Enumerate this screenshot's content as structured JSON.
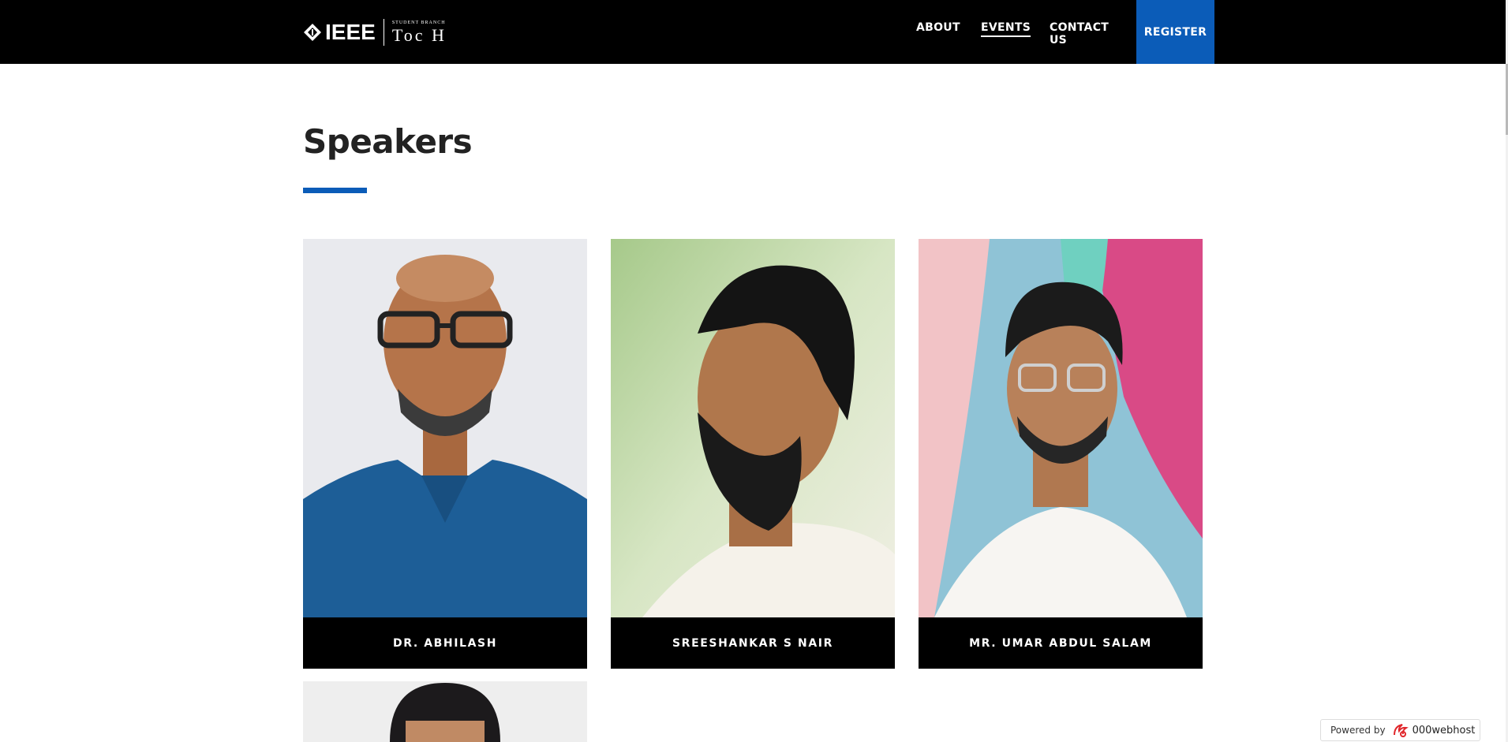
{
  "header": {
    "logo_word": "IEEE",
    "logo_sub": "STUDENT BRANCH",
    "logo_name": "Toc H",
    "nav": {
      "about": "ABOUT",
      "events": "EVENTS",
      "contact": "CONTACT US",
      "register": "REGISTER"
    }
  },
  "main": {
    "title": "Speakers",
    "speakers": [
      {
        "name": "DR. ABHILASH"
      },
      {
        "name": "SREESHANKAR S NAIR"
      },
      {
        "name": "MR. UMAR ABDUL SALAM"
      }
    ]
  },
  "footer_badge": {
    "label": "Powered by",
    "brand": "000webhost"
  },
  "colors": {
    "header_bg": "#000000",
    "accent_blue": "#0b5cb8",
    "nameplate_bg": "#000000"
  },
  "icons": {
    "logo": "ieee-diamond-icon",
    "badge": "000webhost-flame-icon"
  }
}
